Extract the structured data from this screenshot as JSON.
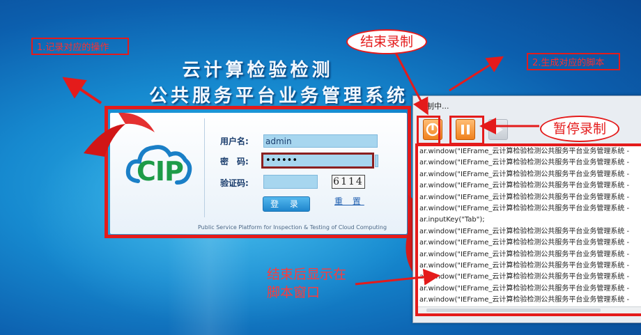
{
  "title": {
    "line1": "云计算检验检测",
    "line2": "公共服务平台业务管理系统"
  },
  "annotations": {
    "step1": "1.记录对应的操作",
    "step2": "2.生成对应的脚本",
    "stop_record": "结束录制",
    "pause_record": "暂停录制",
    "after_end_line1": "结束后显示在",
    "after_end_line2": "脚本窗口"
  },
  "login": {
    "logo_text": "CIP",
    "username_label": "用户名:",
    "username_value": "admin",
    "password_label": "密　码:",
    "password_value": "••••••",
    "captcha_label": "验证码:",
    "captcha_image": "6114",
    "login_button": "登 录",
    "reset_link": "重 置",
    "footer": "Public Service Platform for Inspection & Testing of Cloud Computing"
  },
  "recorder": {
    "title": "录制中...",
    "script_lines": [
      "ar.window(\"IEFrame_云计算检验检测公共服务平台业务管理系统 -",
      "ar.window(\"IEFrame_云计算检验检测公共服务平台业务管理系统 -",
      "ar.window(\"IEFrame_云计算检验检测公共服务平台业务管理系统 -",
      "ar.window(\"IEFrame_云计算检验检测公共服务平台业务管理系统 -",
      "ar.window(\"IEFrame_云计算检验检测公共服务平台业务管理系统 -",
      "ar.window(\"IEFrame_云计算检验检测公共服务平台业务管理系统 -",
      "ar.inputKey(\"Tab\");",
      "ar.window(\"IEFrame_云计算检验检测公共服务平台业务管理系统 -",
      "ar.window(\"IEFrame_云计算检验检测公共服务平台业务管理系统 -",
      "ar.window(\"IEFrame_云计算检验检测公共服务平台业务管理系统 -",
      "ar.window(\"IEFrame_云计算检验检测公共服务平台业务管理系统 -",
      "ar.window(\"IEFrame_云计算检验检测公共服务平台业务管理系统 -",
      "ar.window(\"IEFrame_云计算检验检测公共服务平台业务管理系统 -",
      "ar.window(\"IEFrame_云计算检验检测公共服务平台业务管理系统 -"
    ]
  },
  "colors": {
    "annotation_red": "#e41b1b",
    "record_button_orange": "#f0811d",
    "background_blue": "#1689cf"
  },
  "icons": {
    "stop": "stop-record-icon",
    "pause": "pause-record-icon",
    "play": "play-icon"
  }
}
